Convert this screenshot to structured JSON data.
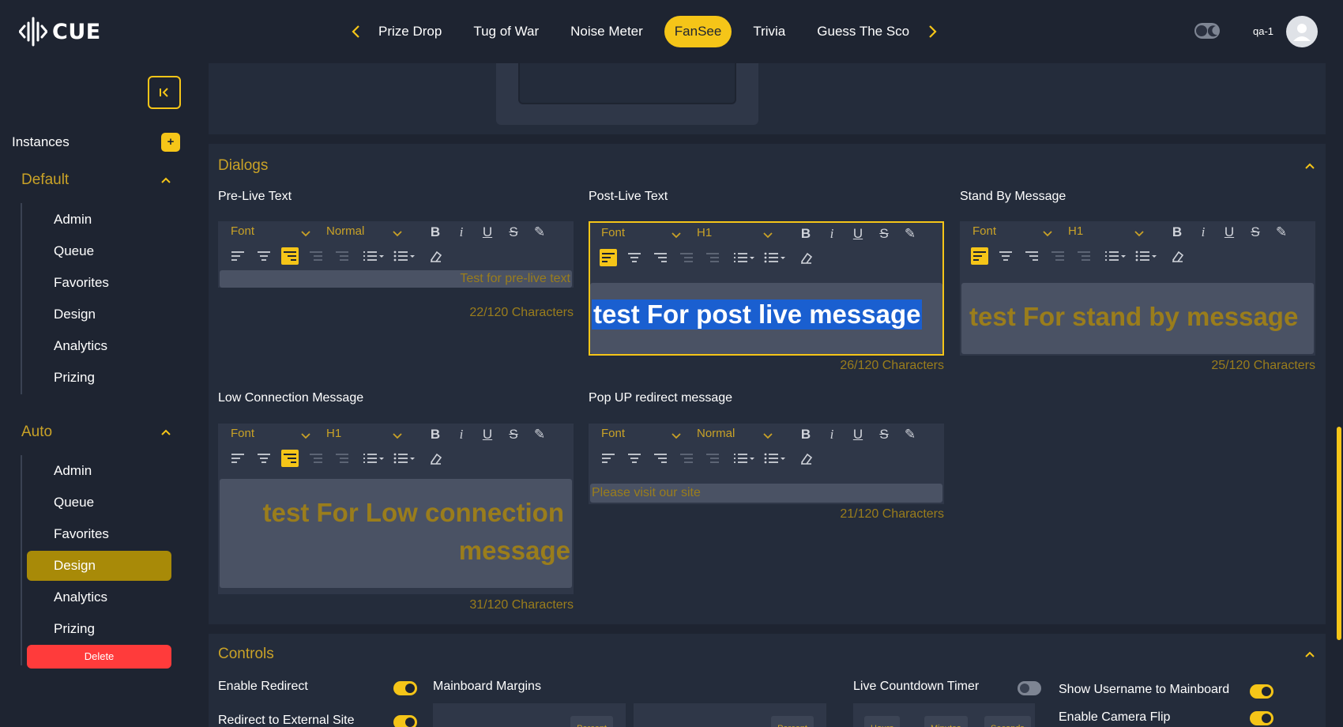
{
  "app": {
    "name": "CUE",
    "username": "qa-1"
  },
  "colors": {
    "accent": "#f5c518",
    "background": "#1e2431",
    "panel": "#242c3b",
    "delete": "#ff3b3b"
  },
  "nav": {
    "tabs": [
      {
        "label": "Prize Drop",
        "active": false
      },
      {
        "label": "Tug of War",
        "active": false
      },
      {
        "label": "Noise Meter",
        "active": false
      },
      {
        "label": "FanSee",
        "active": true
      },
      {
        "label": "Trivia",
        "active": false
      },
      {
        "label": "Guess The Sco",
        "active": false
      }
    ]
  },
  "sidebar": {
    "instances_label": "Instances",
    "add_label": "+",
    "groups": [
      {
        "title": "Default",
        "items": [
          "Admin",
          "Queue",
          "Favorites",
          "Design",
          "Analytics",
          "Prizing"
        ]
      },
      {
        "title": "Auto",
        "items": [
          "Admin",
          "Queue",
          "Favorites",
          "Design",
          "Analytics",
          "Prizing"
        ],
        "active_item": "Design"
      }
    ],
    "delete_label": "Delete"
  },
  "dialogs": {
    "title": "Dialogs",
    "editors": [
      {
        "label": "Pre-Live Text",
        "font": "Font",
        "size": "Normal",
        "text": "Test for pre-live text",
        "count": "22/120 Characters"
      },
      {
        "label": "Post-Live Text",
        "font": "Font",
        "size": "H1",
        "text": "test For post live message",
        "count": "26/120 Characters"
      },
      {
        "label": "Stand By Message",
        "font": "Font",
        "size": "H1",
        "text": "test For stand by message",
        "count": "25/120 Characters"
      },
      {
        "label": "Low Connection Message",
        "font": "Font",
        "size": "H1",
        "text_line1": "test For Low connection",
        "text_line2": "message",
        "count": "31/120 Characters"
      },
      {
        "label": "Pop UP redirect message",
        "font": "Font",
        "size": "Normal",
        "text": "Please visit our site",
        "count": "21/120 Characters"
      }
    ]
  },
  "controls": {
    "title": "Controls",
    "enable_redirect": {
      "label": "Enable Redirect",
      "on": true
    },
    "redirect_external": {
      "label": "Redirect to External Site",
      "on": true
    },
    "mainboard_margins": {
      "label": "Mainboard Margins",
      "unit1": "Percent",
      "unit2": "Percent"
    },
    "countdown": {
      "label": "Live Countdown Timer",
      "on": false,
      "hours": "Hours",
      "minutes": "Minutes",
      "seconds": "Seconds"
    },
    "show_username": {
      "label": "Show Username to Mainboard",
      "on": true
    },
    "camera_flip": {
      "label": "Enable Camera Flip",
      "on": true
    }
  }
}
